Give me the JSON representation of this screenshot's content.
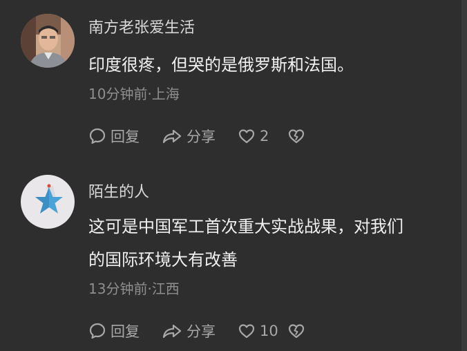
{
  "comments": [
    {
      "username": "南方老张爱生活",
      "lines": [
        "印度很疼，但哭的是俄罗斯和法国。"
      ],
      "meta": "10分钟前·上海",
      "reply_label": "回复",
      "share_label": "分享",
      "like_count": "2"
    },
    {
      "username": "陌生的人",
      "lines": [
        "这可是中国军工首次重大实战战果，对我们",
        "的国际环境大有改善"
      ],
      "meta": "13分钟前·江西",
      "reply_label": "回复",
      "share_label": "分享",
      "like_count": "10"
    }
  ],
  "colors": {
    "background": "#2e2e2f",
    "text": "#f0f0f0",
    "secondary": "#8f8f8f",
    "icon": "#a8a8a8",
    "star": "#4aa3d8"
  }
}
